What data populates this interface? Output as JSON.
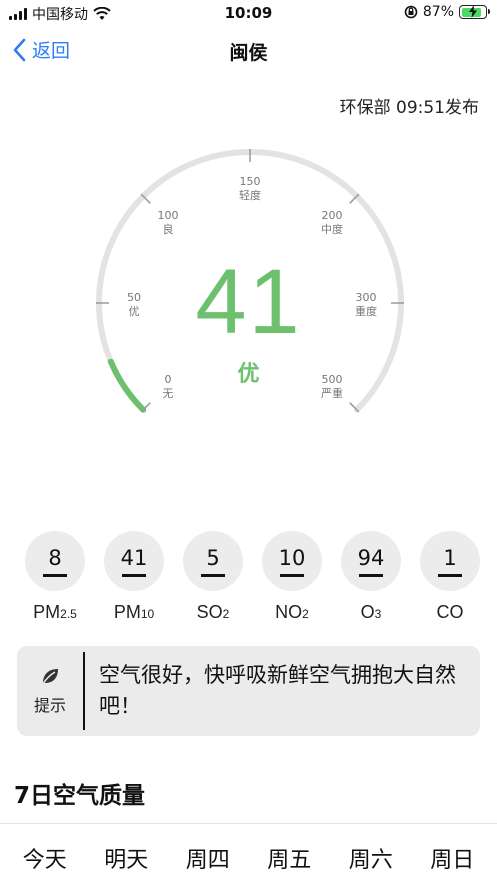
{
  "status_bar": {
    "carrier": "中国移动",
    "time": "10:09",
    "battery": "87%"
  },
  "nav": {
    "back_label": "返回",
    "title": "闽侯"
  },
  "publish_info": "环保部 09:51发布",
  "gauge": {
    "aqi": "41",
    "level": "优",
    "progress_fraction": 0.082,
    "accent_color": "#6dc06e",
    "track_color": "#e3e3e3",
    "ticks": [
      {
        "value": "0",
        "label": "无"
      },
      {
        "value": "50",
        "label": "优"
      },
      {
        "value": "100",
        "label": "良"
      },
      {
        "value": "150",
        "label": "轻度"
      },
      {
        "value": "200",
        "label": "中度"
      },
      {
        "value": "300",
        "label": "重度"
      },
      {
        "value": "500",
        "label": "严重"
      }
    ]
  },
  "pollutants": [
    {
      "value": "8",
      "name": "PM",
      "sub": "2.5"
    },
    {
      "value": "41",
      "name": "PM",
      "sub": "10"
    },
    {
      "value": "5",
      "name": "SO",
      "sub": "2"
    },
    {
      "value": "10",
      "name": "NO",
      "sub": "2"
    },
    {
      "value": "94",
      "name": "O",
      "sub": "3"
    },
    {
      "value": "1",
      "name": "CO",
      "sub": ""
    }
  ],
  "tip": {
    "icon": "leaf-icon",
    "label": "提示",
    "text": "空气很好，快呼吸新鲜空气拥抱大自然吧！"
  },
  "forecast": {
    "title": "7日空气质量",
    "days": [
      "今天",
      "明天",
      "周四",
      "周五",
      "周六",
      "周日"
    ]
  }
}
